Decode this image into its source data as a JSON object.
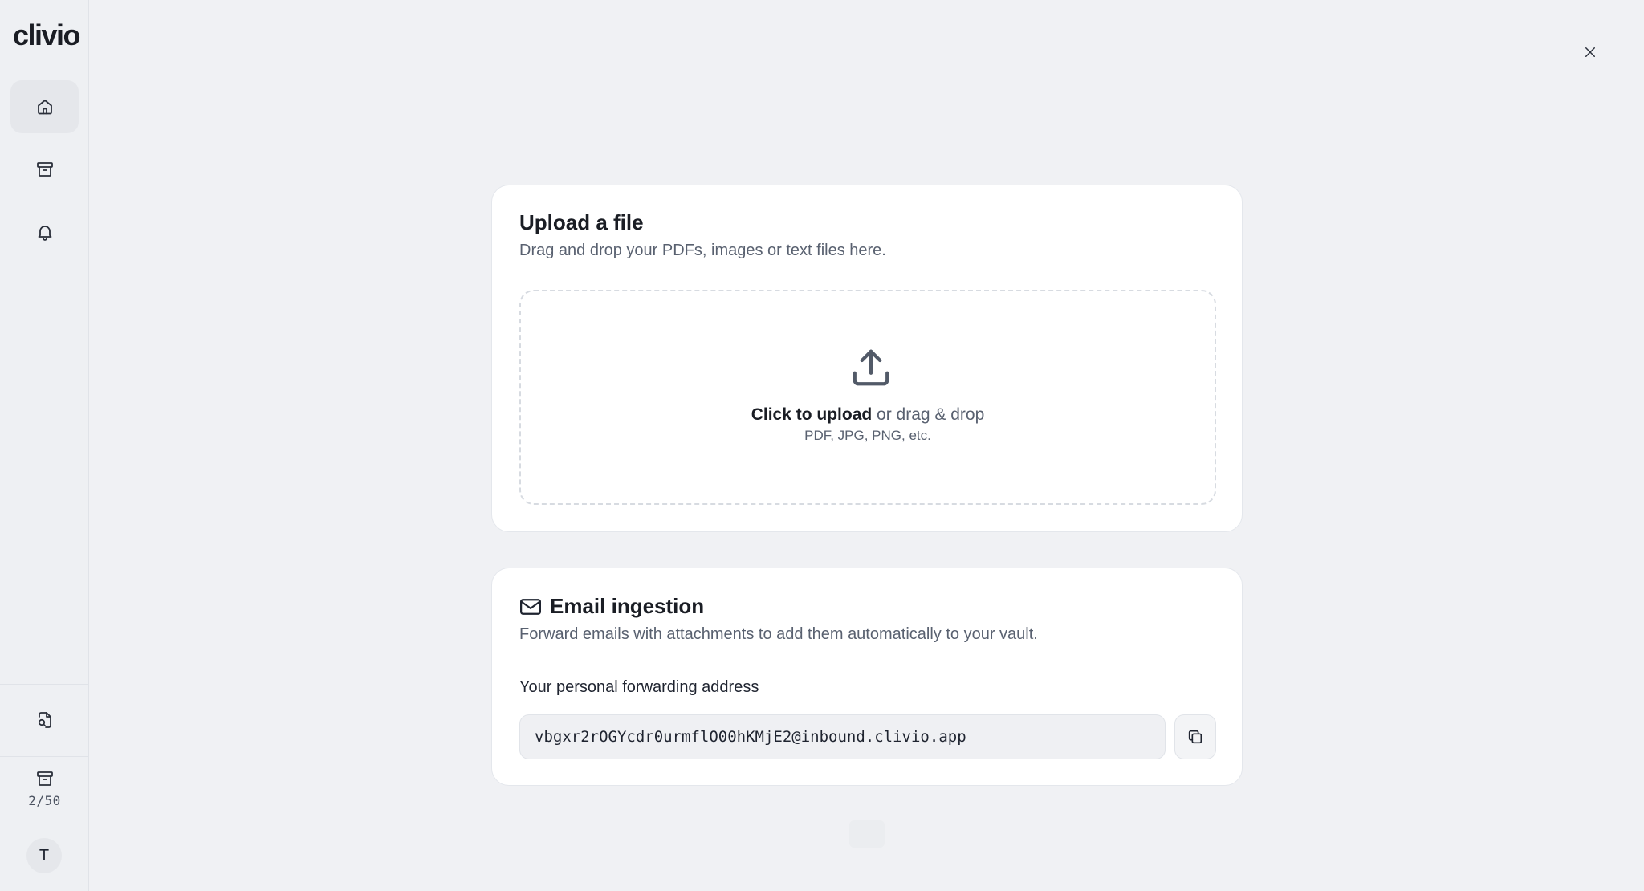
{
  "sidebar": {
    "logo": "clivio",
    "nav": [
      {
        "icon": "home-icon"
      },
      {
        "icon": "archive-icon"
      },
      {
        "icon": "bell-icon"
      }
    ],
    "bottom_icon": "file-search-icon",
    "usage": {
      "icon": "archive-icon",
      "text": "2/50"
    },
    "avatar_initial": "T"
  },
  "close_icon": "close-icon",
  "upload_card": {
    "title": "Upload a file",
    "subtitle": "Drag and drop your PDFs, images or text files here.",
    "dropzone": {
      "icon": "upload-icon",
      "action_bold": "Click to upload",
      "action_rest": " or drag & drop",
      "hint": "PDF, JPG, PNG, etc."
    }
  },
  "email_card": {
    "icon": "mail-icon",
    "title": "Email ingestion",
    "subtitle": "Forward emails with attachments to add them automatically to your vault.",
    "field_label": "Your personal forwarding address",
    "address": "vbgxr2rOGYcdr0urmflO00hKMjE2@inbound.clivio.app",
    "copy_icon": "copy-icon"
  },
  "colors": {
    "background": "#f0f1f4",
    "card": "#ffffff",
    "text": "#1a1d24",
    "muted": "#596170"
  }
}
